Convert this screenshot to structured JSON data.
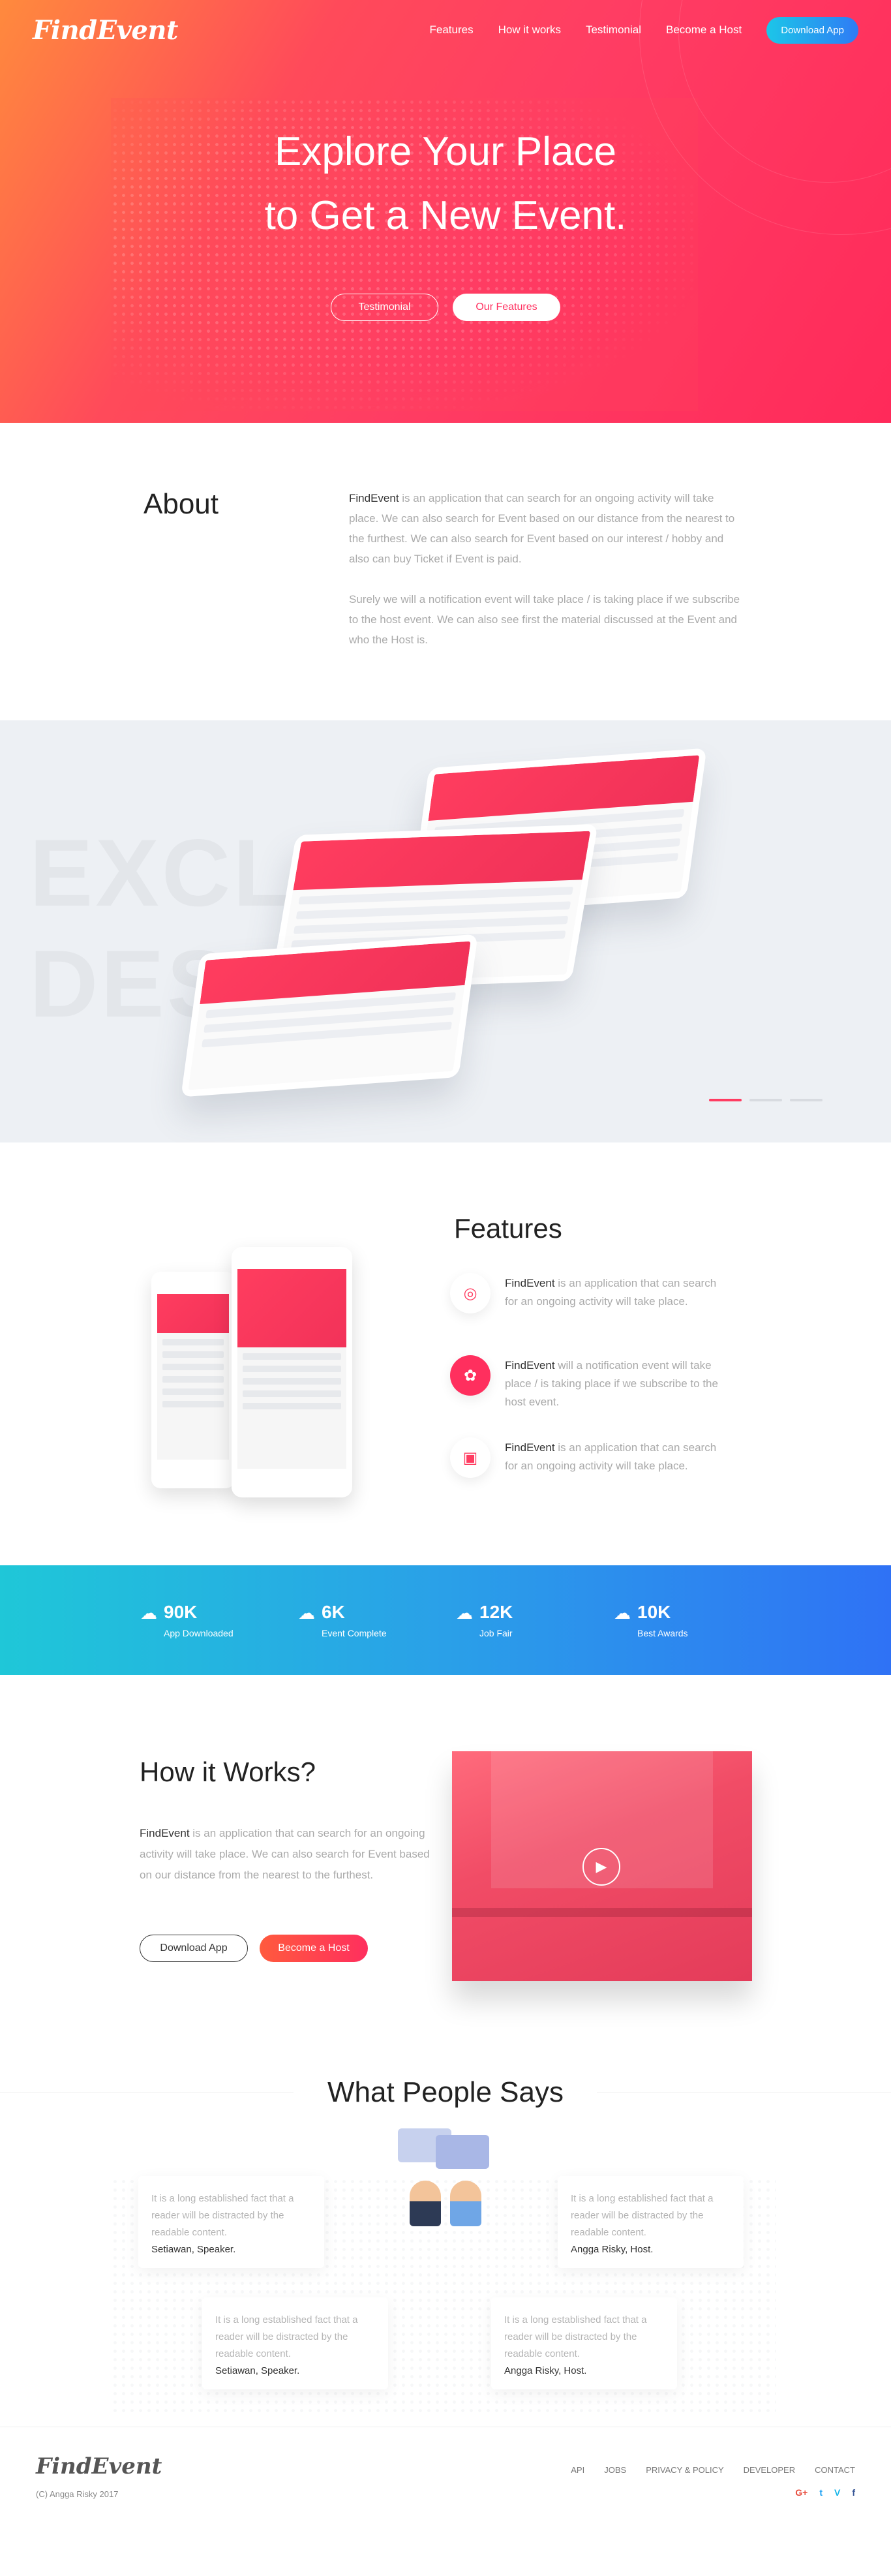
{
  "nav": {
    "logo": "FindEvent",
    "links": [
      "Features",
      "How it works",
      "Testimonial",
      "Become a Host"
    ],
    "download_label": "Download App"
  },
  "hero": {
    "title_line1": "Explore Your Place",
    "title_line2": "to Get a New Event.",
    "btn_testimonial": "Testimonial",
    "btn_features": "Our Features"
  },
  "about": {
    "heading": "About",
    "brand": "FindEvent",
    "para1_rest": " is an application that can search for an ongoing activity will take place. We can also search for Event based on our distance from the nearest to the furthest. We can also search for Event based on our interest / hobby and also can buy Ticket if Event is paid.",
    "para2": "Surely we will a notification event will take place / is taking place if we subscribe to the host event. We can also see first the material discussed at the Event and who the Host is."
  },
  "showcase": {
    "word1": "EXCLUSIVE",
    "word2": "DESIGN",
    "dots": [
      true,
      false,
      false
    ]
  },
  "features": {
    "heading": "Features",
    "items": [
      {
        "icon": "globe-icon",
        "brand": "FindEvent",
        "text": " is an application that can search for an ongoing activity will take place."
      },
      {
        "icon": "award-icon",
        "brand": "FindEvent",
        "text": " will a notification event will take place / is taking place if we subscribe to the host event."
      },
      {
        "icon": "briefcase-icon",
        "brand": "FindEvent",
        "text": " is an application that can search for an ongoing activity will take place."
      }
    ]
  },
  "stats": [
    {
      "value": "90K",
      "label": "App Downloaded"
    },
    {
      "value": "6K",
      "label": "Event Complete"
    },
    {
      "value": "12K",
      "label": "Job Fair"
    },
    {
      "value": "10K",
      "label": "Best Awards"
    }
  ],
  "how": {
    "heading": "How it Works?",
    "brand": "FindEvent",
    "text": " is an application that can search for an ongoing activity will take place. We can also search for Event based on our distance from the nearest to the furthest.",
    "btn_download": "Download App",
    "btn_host": "Become a Host"
  },
  "testimonials": {
    "heading": "What People Says",
    "cards": [
      {
        "quote": "It is a long established fact that a reader will be distracted by the readable content.",
        "author": "Setiawan, Speaker."
      },
      {
        "quote": "It is a long established fact that a reader will be distracted by the readable content.",
        "author": "Angga Risky, Host."
      },
      {
        "quote": "It is a long established fact that a reader will be distracted by the readable content.",
        "author": "Setiawan, Speaker."
      },
      {
        "quote": "It is a long established fact that a reader will be distracted by the readable content.",
        "author": "Angga Risky, Host."
      }
    ]
  },
  "footer": {
    "logo": "FindEvent",
    "copyright": "(C) Angga Risky 2017",
    "links": [
      "API",
      "JOBS",
      "PRIVACY & POLICY",
      "DEVELOPER",
      "CONTACT"
    ],
    "social": [
      {
        "glyph": "G+",
        "icon": "google-plus-icon",
        "color": "#e84c3d"
      },
      {
        "glyph": "t",
        "icon": "twitter-icon",
        "color": "#1da1f2"
      },
      {
        "glyph": "V",
        "icon": "vimeo-icon",
        "color": "#1ab7ea"
      },
      {
        "glyph": "f",
        "icon": "facebook-icon",
        "color": "#3b5998"
      }
    ]
  },
  "colors": {
    "accent": "#ff2f5e",
    "blue": "#2f7bf5",
    "cyan": "#1cc6e8"
  }
}
